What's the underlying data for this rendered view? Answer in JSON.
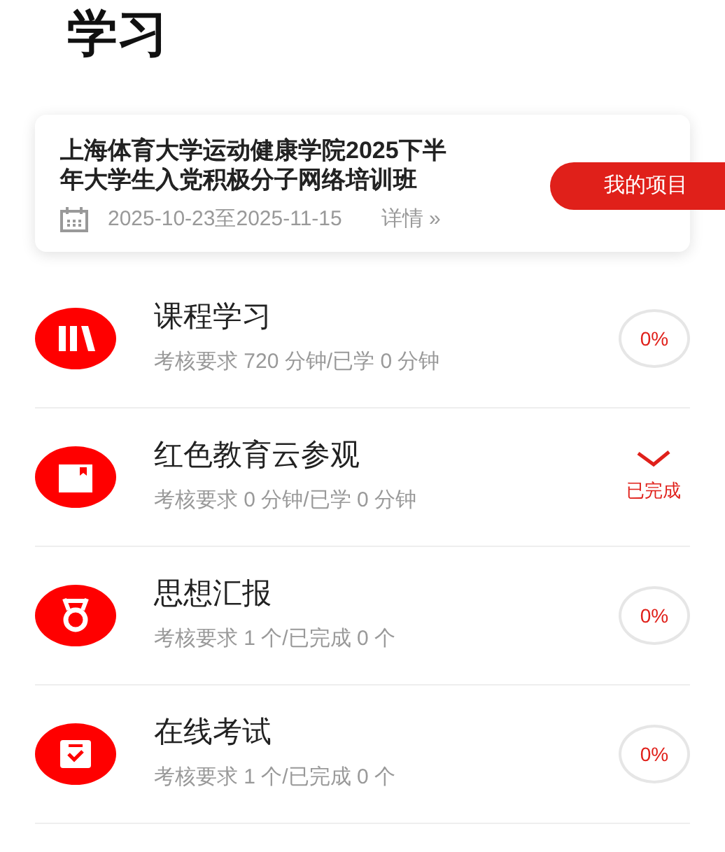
{
  "page_title": "学习",
  "project": {
    "name": "上海体育大学运动健康学院2025下半年大学生入党积极分子网络培训班",
    "dates": "2025-10-23至2025-11-15",
    "details_link": "详情 »"
  },
  "my_projects_button": "我的项目",
  "tasks": [
    {
      "title": "课程学习",
      "requirement": "考核要求 720 分钟/已学 0 分钟",
      "completed": false,
      "progress": "0%"
    },
    {
      "title": "红色教育云参观",
      "requirement": "考核要求 0 分钟/已学 0 分钟",
      "completed": true,
      "status_label": "已完成"
    },
    {
      "title": "思想汇报",
      "requirement": "考核要求 1 个/已完成 0 个",
      "completed": false,
      "progress": "0%"
    },
    {
      "title": "在线考试",
      "requirement": "考核要求 1 个/已完成 0 个",
      "completed": false,
      "progress": "0%"
    }
  ]
}
